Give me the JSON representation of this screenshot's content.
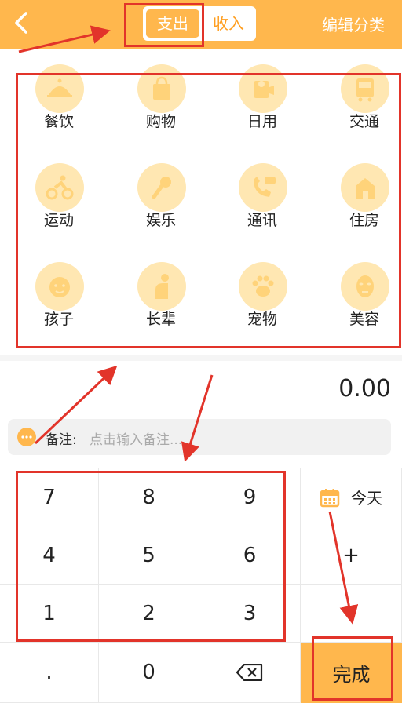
{
  "header": {
    "back_icon": "chevron-left-icon",
    "tabs": [
      {
        "label": "支出"
      },
      {
        "label": "收入"
      }
    ],
    "edit_label": "编辑分类"
  },
  "categories": [
    {
      "label": "餐饮",
      "icon": "dish-icon"
    },
    {
      "label": "购物",
      "icon": "shopping-bag-icon"
    },
    {
      "label": "日用",
      "icon": "tissue-roll-icon"
    },
    {
      "label": "交通",
      "icon": "bus-icon"
    },
    {
      "label": "运动",
      "icon": "cyclist-icon"
    },
    {
      "label": "娱乐",
      "icon": "microphone-icon"
    },
    {
      "label": "通讯",
      "icon": "phone-icon"
    },
    {
      "label": "住房",
      "icon": "house-icon"
    },
    {
      "label": "孩子",
      "icon": "baby-icon"
    },
    {
      "label": "长辈",
      "icon": "elder-icon"
    },
    {
      "label": "宠物",
      "icon": "paw-icon"
    },
    {
      "label": "美容",
      "icon": "face-mask-icon"
    }
  ],
  "amount": "0.00",
  "remark": {
    "label": "备注:",
    "placeholder": "点击输入备注..."
  },
  "keypad": {
    "rows": [
      [
        "7",
        "8",
        "9"
      ],
      [
        "4",
        "5",
        "6"
      ],
      [
        "1",
        "2",
        "3"
      ],
      [
        ".",
        "0",
        ""
      ]
    ],
    "today": "今天",
    "plus": "+",
    "done": "完成"
  },
  "colors": {
    "accent": "#ffb74d",
    "tab_text": "#ff9e1f",
    "icon_bg": "#ffe7b2",
    "highlight": "#e2342a"
  }
}
